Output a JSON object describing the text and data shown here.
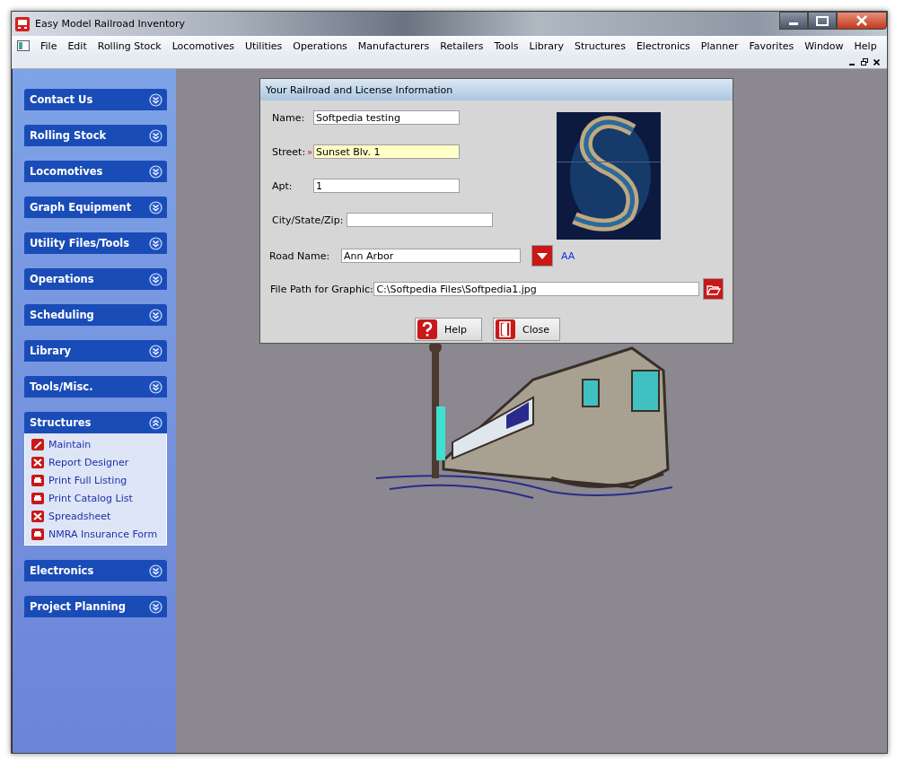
{
  "window": {
    "title": "Easy Model Railroad Inventory"
  },
  "menu": [
    "File",
    "Edit",
    "Rolling Stock",
    "Locomotives",
    "Utilities",
    "Operations",
    "Manufacturers",
    "Retailers",
    "Tools",
    "Library",
    "Structures",
    "Electronics",
    "Planner",
    "Favorites",
    "Window",
    "Help"
  ],
  "sidebar": [
    {
      "label": "Contact Us",
      "expanded": false
    },
    {
      "label": "Rolling Stock",
      "expanded": false
    },
    {
      "label": "Locomotives",
      "expanded": false
    },
    {
      "label": "Graph Equipment",
      "expanded": false
    },
    {
      "label": "Utility Files/Tools",
      "expanded": false
    },
    {
      "label": "Operations",
      "expanded": false
    },
    {
      "label": "Scheduling",
      "expanded": false
    },
    {
      "label": "Library",
      "expanded": false
    },
    {
      "label": "Tools/Misc.",
      "expanded": false
    },
    {
      "label": "Structures",
      "expanded": true,
      "items": [
        {
          "label": "Maintain",
          "kind": "edit"
        },
        {
          "label": "Report Designer",
          "kind": "tools"
        },
        {
          "label": "Print Full Listing",
          "kind": "print"
        },
        {
          "label": "Print Catalog List",
          "kind": "print"
        },
        {
          "label": "Spreadsheet",
          "kind": "tools"
        },
        {
          "label": "NMRA Insurance Form",
          "kind": "print"
        }
      ]
    },
    {
      "label": "Electronics",
      "expanded": false
    },
    {
      "label": "Project Planning",
      "expanded": false
    }
  ],
  "dialog": {
    "title": "Your Railroad and License Information",
    "fields": [
      {
        "label": "Name:",
        "value": "Softpedia testing",
        "kind": "text",
        "focused": false
      },
      {
        "label": "Street:",
        "value": "Sunset Blv. 1",
        "kind": "text",
        "focused": true,
        "marker": "»"
      },
      {
        "label": "Apt:",
        "value": "1",
        "kind": "text",
        "focused": false
      },
      {
        "label": "City/State/Zip:",
        "kind": "text",
        "focused": false
      },
      {
        "label": "Road Name:",
        "value": "Ann Arbor",
        "kind": "combo",
        "link": "AA"
      },
      {
        "label": "File Path for Graphic:",
        "value": "C:\\Softpedia Files\\Softpedia1.jpg",
        "kind": "file"
      }
    ],
    "buttons": [
      {
        "label": "Help",
        "kind": "help"
      },
      {
        "label": "Close",
        "kind": "close"
      }
    ]
  }
}
